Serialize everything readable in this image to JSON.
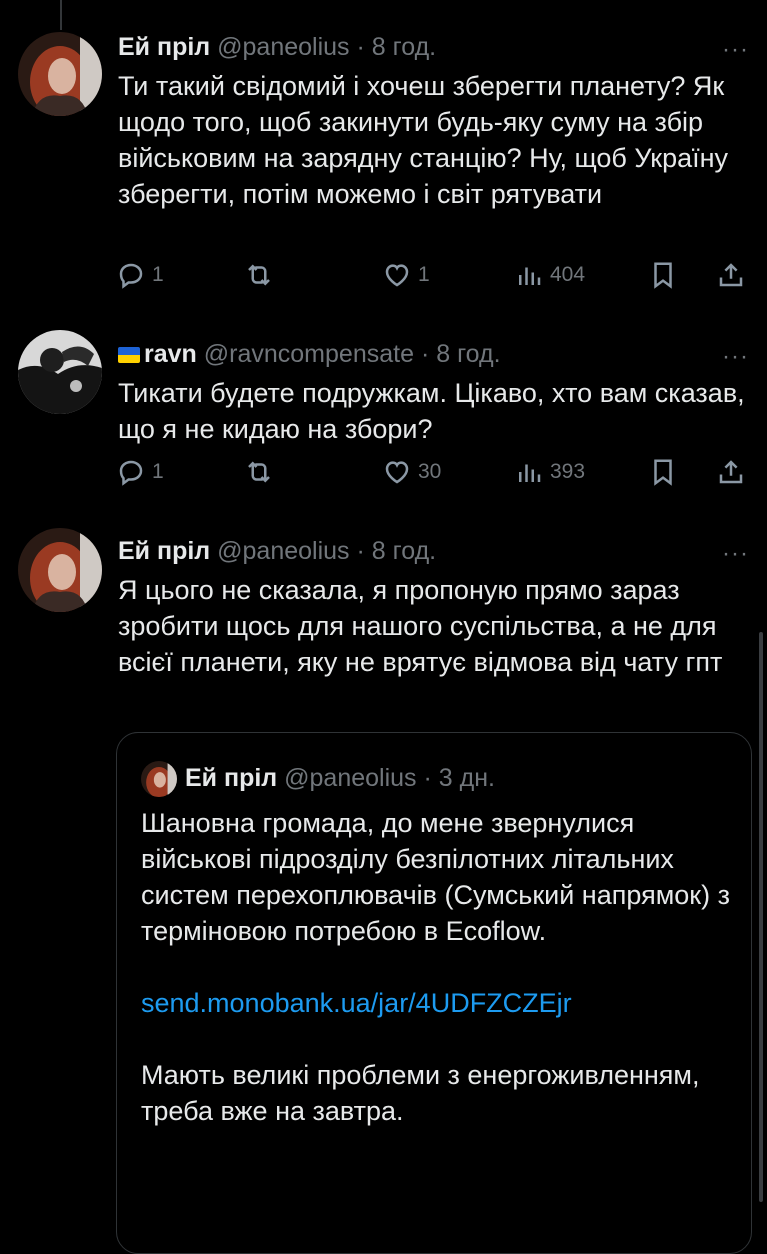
{
  "tweets": [
    {
      "name": "Ей пріл",
      "handle": "@paneolius",
      "separator": "·",
      "time": "8 год.",
      "text": "Ти такий свідомий і хочеш зберегти планету? Як щодо того, щоб закинути будь-яку суму на збір військовим на зарядну станцію? Ну, щоб Україну зберегти, потім можемо і світ рятувати",
      "replies": "1",
      "retweets": "",
      "likes": "1",
      "views": "404"
    },
    {
      "name": "ravn",
      "handle": "@ravncompensate",
      "separator": "·",
      "time": "8 год.",
      "text": "Тикати будете подружкам. Цікаво, хто вам сказав, що я не кидаю на збори?",
      "replies": "1",
      "retweets": "",
      "likes": "30",
      "views": "393"
    },
    {
      "name": "Ей пріл",
      "handle": "@paneolius",
      "separator": "·",
      "time": "8 год.",
      "text": "Я цього не сказала, я пропоную прямо зараз зробити щось для нашого суспільства, а не для всієї планети, яку не врятує відмова від чату гпт"
    }
  ],
  "quote": {
    "name": "Ей пріл",
    "handle": "@paneolius",
    "separator": "·",
    "time": "3 дн.",
    "para1": "Шановна громада, до мене звернулися військові підрозділу безпілотних літальних систем перехоплювачів (Сумський напрямок) з терміновою потребою в Ecoflow.",
    "link": "send.monobank.ua/jar/4UDFZCZEjr",
    "para2": "Мають великі проблеми з енергоживленням, треба вже на завтра."
  },
  "more_glyph": "···",
  "icons": [
    "reply-icon",
    "retweet-icon",
    "like-icon",
    "views-icon",
    "bookmark-icon",
    "share-icon",
    "more-icon",
    "ukraine-flag-icon"
  ],
  "colors": {
    "background": "#000000",
    "text": "#e7e9ea",
    "muted": "#71767b",
    "link": "#1d9bf0",
    "border": "#2f3336"
  }
}
